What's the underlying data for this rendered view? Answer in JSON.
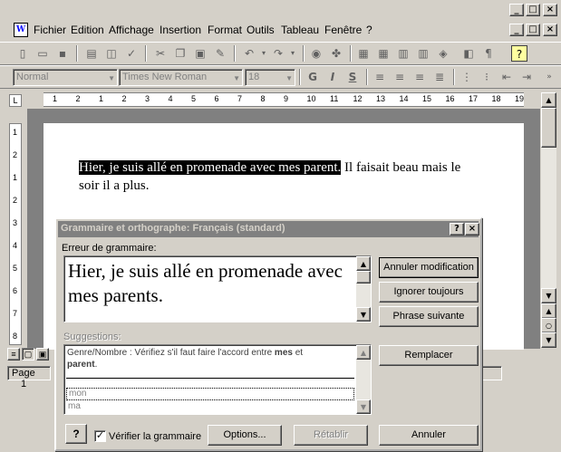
{
  "app": {
    "window_controls": [
      "_",
      "□",
      "×"
    ]
  },
  "menubar": {
    "items": [
      "Fichier",
      "Edition",
      "Affichage",
      "Insertion",
      "Format",
      "Outils",
      "Tableau",
      "Fenêtre",
      "?"
    ],
    "doc_controls": [
      "_",
      "□",
      "×"
    ]
  },
  "toolbar": {
    "style_combo": "Normal",
    "font_combo": "Times New Roman",
    "size_combo": "18",
    "bold": "G",
    "italic": "I",
    "underline": "S"
  },
  "ruler": {
    "numbers": [
      "1",
      "2",
      "1",
      "2",
      "3",
      "4",
      "5",
      "6",
      "7",
      "8",
      "9",
      "10",
      "11",
      "12",
      "13",
      "14",
      "15",
      "16",
      "17",
      "18",
      "19"
    ],
    "vnumbers": [
      "1",
      "2",
      "1",
      "2",
      "3",
      "4",
      "5",
      "6",
      "7",
      "8"
    ]
  },
  "document": {
    "selected_text": "Hier, je suis allé en promenade avec mes parent.",
    "rest_line1": " Il faisait beau mais le",
    "line2": "soir il a plus."
  },
  "statusbar": {
    "page": "Page",
    "page_num": "1"
  },
  "dialog": {
    "title": "Grammaire et orthographe: Français (standard)",
    "help": "?",
    "close": "×",
    "error_label": "Erreur de grammaire:",
    "error_text": "Hier, je suis allé en promenade avec mes parents.",
    "btn_ignore": "Annuler modification",
    "btn_ignore_all": "Ignorer toujours",
    "btn_next": "Phrase suivante",
    "suggestions_label": "Suggestions:",
    "suggestion_desc_pre": "Genre/Nombre : Vérifiez s'il faut faire l'accord entre ",
    "suggestion_desc_w1": "mes",
    "suggestion_desc_mid": " et",
    "suggestion_desc_w2": "parent",
    "suggestion_desc_end": ".",
    "suggestions": [
      "mon",
      "ma"
    ],
    "btn_replace": "Remplacer",
    "check_grammar": "Vérifier la grammaire",
    "btn_options": "Options...",
    "btn_undo": "Rétablir",
    "btn_cancel": "Annuler"
  }
}
